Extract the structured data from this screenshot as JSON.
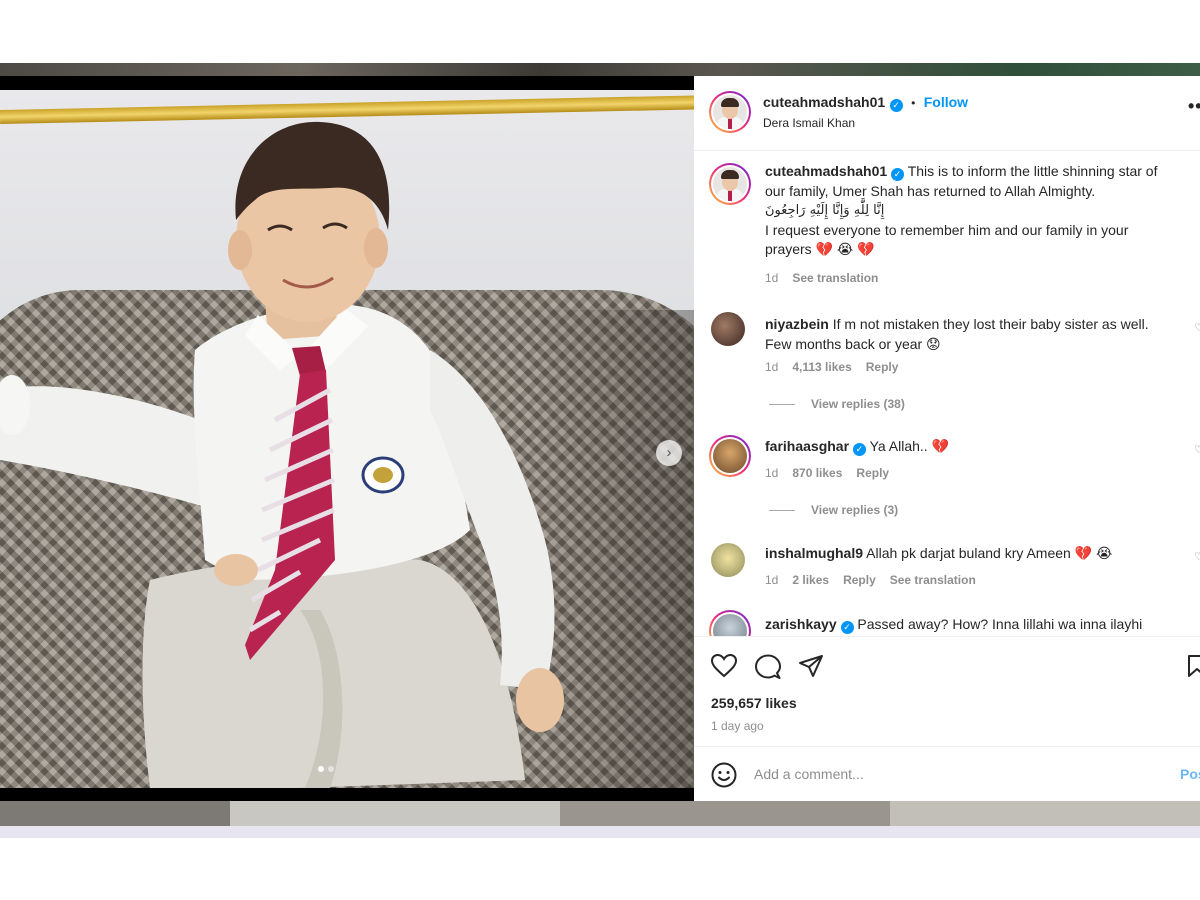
{
  "post": {
    "author": "cuteahmadshah01",
    "follow_label": "Follow",
    "dot_separator": "•",
    "location": "Dera Ismail Khan",
    "verified": true,
    "media_next_label": "›",
    "media_slide_count": 2,
    "media_active_slide": 1
  },
  "caption": {
    "username": "cuteahmadshah01",
    "text_line1": "This is to inform the little shinning star of",
    "text_line2": "our family, Umer Shah has returned to Allah Almighty.",
    "arabic": "إِنَّا لِلَّٰهِ وَإِنَّا إِلَيْهِ رَاجِعُونَ",
    "text_line3": "I request everyone to remember him and our family in your",
    "text_line4": "prayers 💔 😭 💔",
    "time": "1d",
    "see_translation": "See translation"
  },
  "comments": [
    {
      "username": "niyazbein",
      "text_line1": "If m not mistaken they lost their baby sister as well.",
      "text_line2": "Few months back or year 😟",
      "time": "1d",
      "likes": "4,113 likes",
      "reply": "Reply",
      "view_replies": "View replies (38)"
    },
    {
      "username": "farihaasghar",
      "text": "Ya Allah.. 💔",
      "verified": true,
      "time": "1d",
      "likes": "870 likes",
      "reply": "Reply",
      "view_replies": "View replies (3)"
    },
    {
      "username": "inshalmughal9",
      "text": "Allah pk darjat buland kry Ameen 💔 😭",
      "time": "1d",
      "likes": "2 likes",
      "reply": "Reply",
      "see_translation": "See translation"
    },
    {
      "username": "zarishkayy",
      "text": "Passed away? How? Inna lillahi wa inna ilayhi",
      "verified": true
    }
  ],
  "actions": {
    "likes": "259,657 likes",
    "time_ago": "1 day ago"
  },
  "add_comment": {
    "placeholder": "Add a comment...",
    "post_label": "Post"
  },
  "colors": {
    "accent_blue": "#0095f6",
    "muted_text": "#8e8e8e",
    "story_ring": [
      "#f9ce34",
      "#ee2a7b",
      "#6228d7"
    ]
  }
}
